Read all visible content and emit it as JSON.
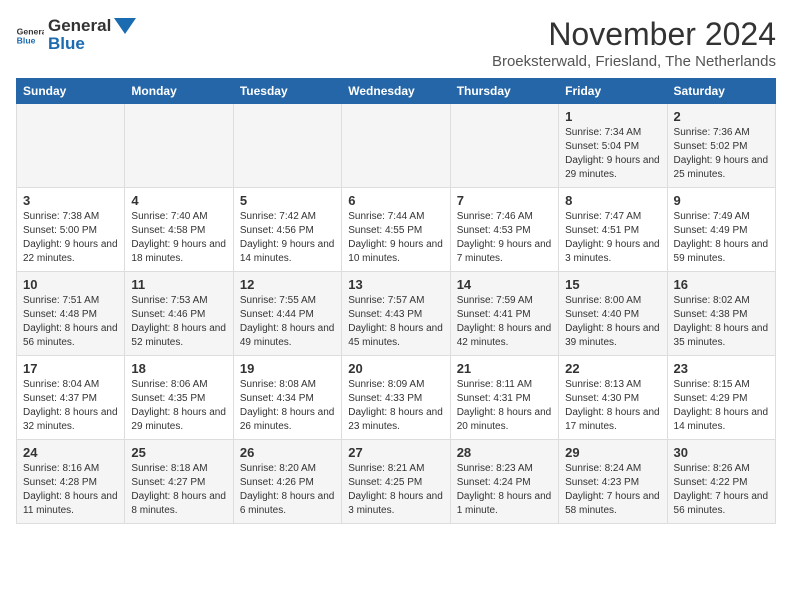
{
  "logo": {
    "general": "General",
    "blue": "Blue"
  },
  "title": "November 2024",
  "location": "Broeksterwald, Friesland, The Netherlands",
  "days_of_week": [
    "Sunday",
    "Monday",
    "Tuesday",
    "Wednesday",
    "Thursday",
    "Friday",
    "Saturday"
  ],
  "weeks": [
    [
      {
        "day": "",
        "info": ""
      },
      {
        "day": "",
        "info": ""
      },
      {
        "day": "",
        "info": ""
      },
      {
        "day": "",
        "info": ""
      },
      {
        "day": "",
        "info": ""
      },
      {
        "day": "1",
        "info": "Sunrise: 7:34 AM\nSunset: 5:04 PM\nDaylight: 9 hours and 29 minutes."
      },
      {
        "day": "2",
        "info": "Sunrise: 7:36 AM\nSunset: 5:02 PM\nDaylight: 9 hours and 25 minutes."
      }
    ],
    [
      {
        "day": "3",
        "info": "Sunrise: 7:38 AM\nSunset: 5:00 PM\nDaylight: 9 hours and 22 minutes."
      },
      {
        "day": "4",
        "info": "Sunrise: 7:40 AM\nSunset: 4:58 PM\nDaylight: 9 hours and 18 minutes."
      },
      {
        "day": "5",
        "info": "Sunrise: 7:42 AM\nSunset: 4:56 PM\nDaylight: 9 hours and 14 minutes."
      },
      {
        "day": "6",
        "info": "Sunrise: 7:44 AM\nSunset: 4:55 PM\nDaylight: 9 hours and 10 minutes."
      },
      {
        "day": "7",
        "info": "Sunrise: 7:46 AM\nSunset: 4:53 PM\nDaylight: 9 hours and 7 minutes."
      },
      {
        "day": "8",
        "info": "Sunrise: 7:47 AM\nSunset: 4:51 PM\nDaylight: 9 hours and 3 minutes."
      },
      {
        "day": "9",
        "info": "Sunrise: 7:49 AM\nSunset: 4:49 PM\nDaylight: 8 hours and 59 minutes."
      }
    ],
    [
      {
        "day": "10",
        "info": "Sunrise: 7:51 AM\nSunset: 4:48 PM\nDaylight: 8 hours and 56 minutes."
      },
      {
        "day": "11",
        "info": "Sunrise: 7:53 AM\nSunset: 4:46 PM\nDaylight: 8 hours and 52 minutes."
      },
      {
        "day": "12",
        "info": "Sunrise: 7:55 AM\nSunset: 4:44 PM\nDaylight: 8 hours and 49 minutes."
      },
      {
        "day": "13",
        "info": "Sunrise: 7:57 AM\nSunset: 4:43 PM\nDaylight: 8 hours and 45 minutes."
      },
      {
        "day": "14",
        "info": "Sunrise: 7:59 AM\nSunset: 4:41 PM\nDaylight: 8 hours and 42 minutes."
      },
      {
        "day": "15",
        "info": "Sunrise: 8:00 AM\nSunset: 4:40 PM\nDaylight: 8 hours and 39 minutes."
      },
      {
        "day": "16",
        "info": "Sunrise: 8:02 AM\nSunset: 4:38 PM\nDaylight: 8 hours and 35 minutes."
      }
    ],
    [
      {
        "day": "17",
        "info": "Sunrise: 8:04 AM\nSunset: 4:37 PM\nDaylight: 8 hours and 32 minutes."
      },
      {
        "day": "18",
        "info": "Sunrise: 8:06 AM\nSunset: 4:35 PM\nDaylight: 8 hours and 29 minutes."
      },
      {
        "day": "19",
        "info": "Sunrise: 8:08 AM\nSunset: 4:34 PM\nDaylight: 8 hours and 26 minutes."
      },
      {
        "day": "20",
        "info": "Sunrise: 8:09 AM\nSunset: 4:33 PM\nDaylight: 8 hours and 23 minutes."
      },
      {
        "day": "21",
        "info": "Sunrise: 8:11 AM\nSunset: 4:31 PM\nDaylight: 8 hours and 20 minutes."
      },
      {
        "day": "22",
        "info": "Sunrise: 8:13 AM\nSunset: 4:30 PM\nDaylight: 8 hours and 17 minutes."
      },
      {
        "day": "23",
        "info": "Sunrise: 8:15 AM\nSunset: 4:29 PM\nDaylight: 8 hours and 14 minutes."
      }
    ],
    [
      {
        "day": "24",
        "info": "Sunrise: 8:16 AM\nSunset: 4:28 PM\nDaylight: 8 hours and 11 minutes."
      },
      {
        "day": "25",
        "info": "Sunrise: 8:18 AM\nSunset: 4:27 PM\nDaylight: 8 hours and 8 minutes."
      },
      {
        "day": "26",
        "info": "Sunrise: 8:20 AM\nSunset: 4:26 PM\nDaylight: 8 hours and 6 minutes."
      },
      {
        "day": "27",
        "info": "Sunrise: 8:21 AM\nSunset: 4:25 PM\nDaylight: 8 hours and 3 minutes."
      },
      {
        "day": "28",
        "info": "Sunrise: 8:23 AM\nSunset: 4:24 PM\nDaylight: 8 hours and 1 minute."
      },
      {
        "day": "29",
        "info": "Sunrise: 8:24 AM\nSunset: 4:23 PM\nDaylight: 7 hours and 58 minutes."
      },
      {
        "day": "30",
        "info": "Sunrise: 8:26 AM\nSunset: 4:22 PM\nDaylight: 7 hours and 56 minutes."
      }
    ]
  ]
}
